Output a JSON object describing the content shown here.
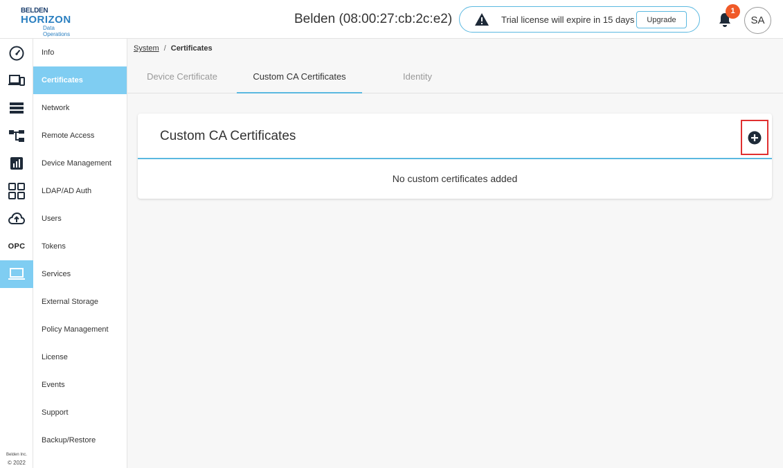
{
  "header": {
    "logo_top": "BELDEN",
    "logo_main": "HORIZON",
    "logo_sub": "Data Operations",
    "device_title": "Belden (08:00:27:cb:2c:e2)",
    "trial_message": "Trial license will expire in 15 days",
    "upgrade_label": "Upgrade",
    "notification_count": "1",
    "avatar_initials": "SA"
  },
  "rail": {
    "icons": [
      "dashboard-icon",
      "devices-icon",
      "list-icon",
      "topology-icon",
      "analytics-icon",
      "apps-grid-icon",
      "cloud-upload-icon",
      "opc-icon",
      "system-laptop-icon"
    ],
    "opc_label": "OPC",
    "active": "system-laptop-icon",
    "copyright_line1": "Belden Inc.",
    "copyright_line2": "© 2022"
  },
  "subnav": {
    "items": [
      {
        "label": "Info"
      },
      {
        "label": "Certificates"
      },
      {
        "label": "Network"
      },
      {
        "label": "Remote Access"
      },
      {
        "label": "Device Management"
      },
      {
        "label": "LDAP/AD Auth"
      },
      {
        "label": "Users"
      },
      {
        "label": "Tokens"
      },
      {
        "label": "Services"
      },
      {
        "label": "External Storage"
      },
      {
        "label": "Policy Management"
      },
      {
        "label": "License"
      },
      {
        "label": "Events"
      },
      {
        "label": "Support"
      },
      {
        "label": "Backup/Restore"
      }
    ],
    "active": "Certificates"
  },
  "breadcrumb": {
    "parent": "System",
    "separator": "/",
    "current": "Certificates"
  },
  "tabs": [
    {
      "label": "Device Certificate"
    },
    {
      "label": "Custom CA Certificates"
    },
    {
      "label": "Identity"
    }
  ],
  "active_tab": "Custom CA Certificates",
  "card": {
    "title": "Custom CA Certificates",
    "empty_message": "No custom certificates added",
    "add_icon": "plus-circle-icon"
  },
  "colors": {
    "accent": "#7fcdf2",
    "accent_border": "#5ab8e0",
    "badge": "#f05a28",
    "highlight": "#e02f2f"
  }
}
